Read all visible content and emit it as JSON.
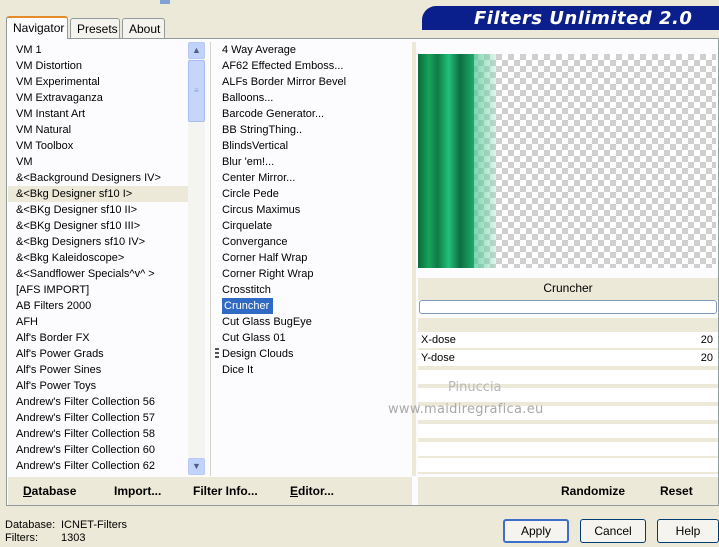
{
  "header": {
    "brand": "Filters Unlimited 2.0"
  },
  "tabs": [
    {
      "label": "Navigator",
      "active": true
    },
    {
      "label": "Presets",
      "active": false
    },
    {
      "label": "About",
      "active": false
    }
  ],
  "categories": {
    "items": [
      "VM 1",
      "VM Distortion",
      "VM Experimental",
      "VM Extravaganza",
      "VM Instant Art",
      "VM Natural",
      "VM Toolbox",
      "VM",
      "&<Background Designers IV>",
      "&<Bkg Designer sf10 I>",
      "&<BKg Designer sf10 II>",
      "&<BKg Designer sf10 III>",
      "&<Bkg Designers sf10 IV>",
      "&<Bkg Kaleidoscope>",
      "&<Sandflower Specials^v^ >",
      "[AFS IMPORT]",
      "AB Filters 2000",
      "AFH",
      "Alf's Border FX",
      "Alf's Power Grads",
      "Alf's Power Sines",
      "Alf's Power Toys",
      "Andrew's Filter Collection 56",
      "Andrew's Filter Collection 57",
      "Andrew's Filter Collection 58",
      "Andrew's Filter Collection 60",
      "Andrew's Filter Collection 62"
    ],
    "selected_index": 9
  },
  "filters": {
    "items": [
      "4 Way Average",
      "AF62 Effected Emboss...",
      "ALFs Border Mirror Bevel",
      "Balloons...",
      "Barcode Generator...",
      "BB StringThing..",
      "BlindsVertical",
      "Blur 'em!...",
      "Center Mirror...",
      "Circle Pede",
      "Circus Maximus",
      "Cirquelate",
      "Convergance",
      "Corner Half Wrap",
      "Corner Right Wrap",
      "Crosstitch",
      "Cruncher",
      "Cut Glass  BugEye",
      "Cut Glass 01",
      "Design Clouds",
      "Dice It"
    ],
    "selected_index": 16
  },
  "preview": {
    "filter_name": "Cruncher"
  },
  "params": [
    {
      "label": "X-dose",
      "value": "20"
    },
    {
      "label": "Y-dose",
      "value": "20"
    }
  ],
  "watermark": {
    "line1": "Pinuccia",
    "line2": "www.maidiregrafica.eu"
  },
  "toolbar_left": [
    "Database",
    "Import...",
    "Filter Info...",
    "Editor..."
  ],
  "toolbar_right": [
    "Randomize",
    "Reset"
  ],
  "status": {
    "database_label": "Database:",
    "database_value": "ICNET-Filters",
    "filters_label": "Filters:",
    "filters_value": "1303"
  },
  "buttons": {
    "apply": "Apply",
    "cancel": "Cancel",
    "help": "Help"
  },
  "colors": {
    "brand_bar": "#0a1e8c",
    "selection": "#316ac5",
    "tab_accent": "#e68b2c"
  }
}
